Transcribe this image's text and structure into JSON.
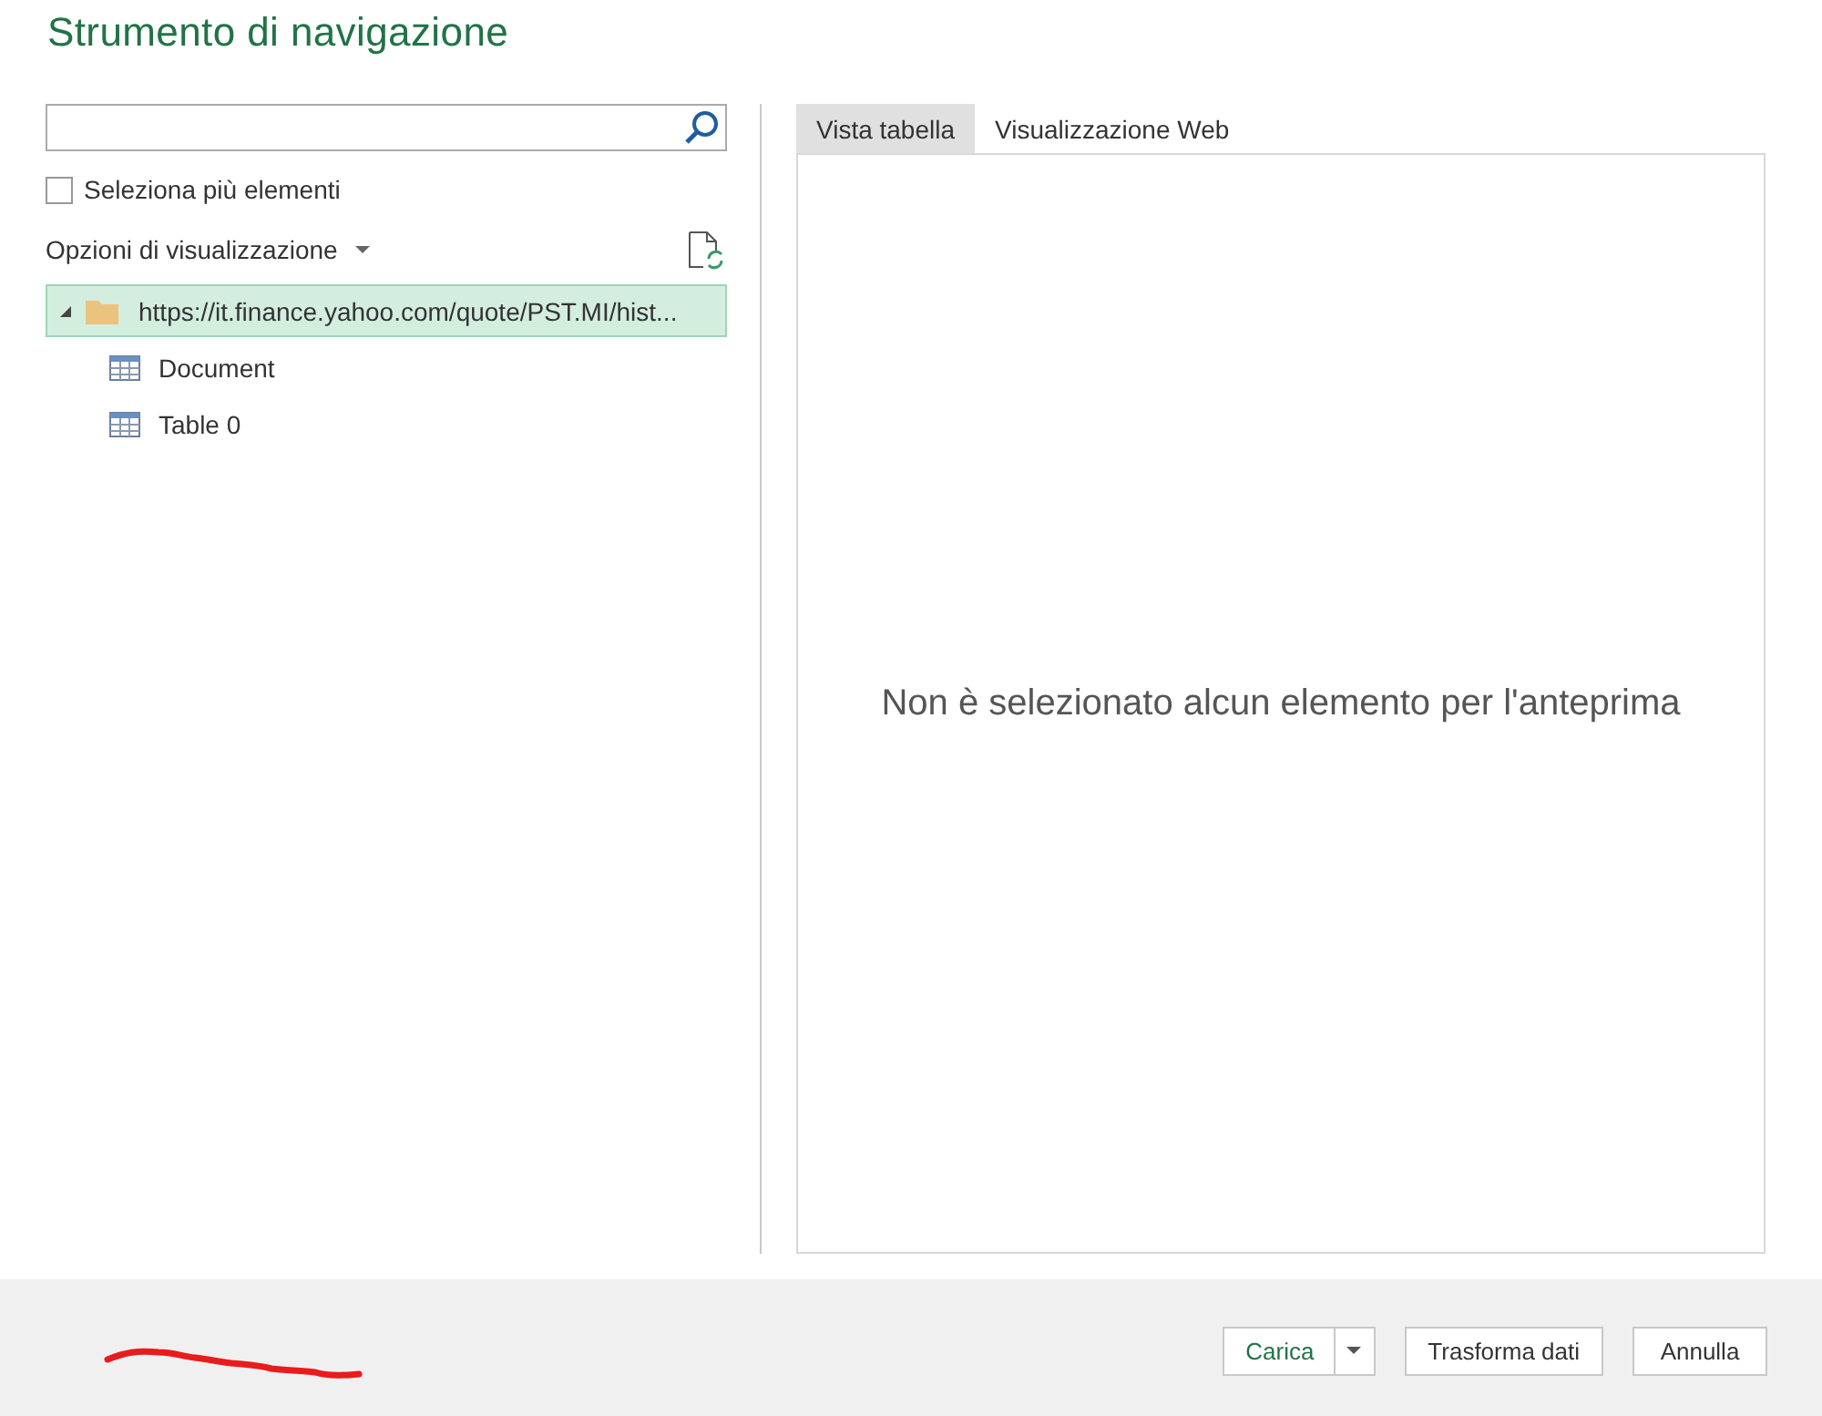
{
  "window": {
    "title": "Strumento di navigazione"
  },
  "multi_select": {
    "label": "Seleziona più elementi",
    "checked": false
  },
  "view_options": {
    "label": "Opzioni di visualizzazione"
  },
  "tree": [
    {
      "label": "https://it.finance.yahoo.com/quote/PST.MI/hist...",
      "kind": "folder",
      "selected": true,
      "expanded": true,
      "children": [
        {
          "label": "Document",
          "kind": "table",
          "selected": false
        },
        {
          "label": "Table 0",
          "kind": "table",
          "selected": false
        }
      ]
    }
  ],
  "tabs": [
    {
      "label": "Vista tabella",
      "selected": true
    },
    {
      "label": "Visualizzazione Web",
      "selected": false
    }
  ],
  "preview": {
    "message": "Non è selezionato alcun elemento per l'anteprima"
  },
  "buttons": [
    {
      "label": "Carica",
      "kind": "split",
      "primary": true
    },
    {
      "label": "Trasforma dati",
      "kind": "plain",
      "primary": false
    },
    {
      "label": "Annulla",
      "kind": "plain",
      "primary": false
    }
  ]
}
